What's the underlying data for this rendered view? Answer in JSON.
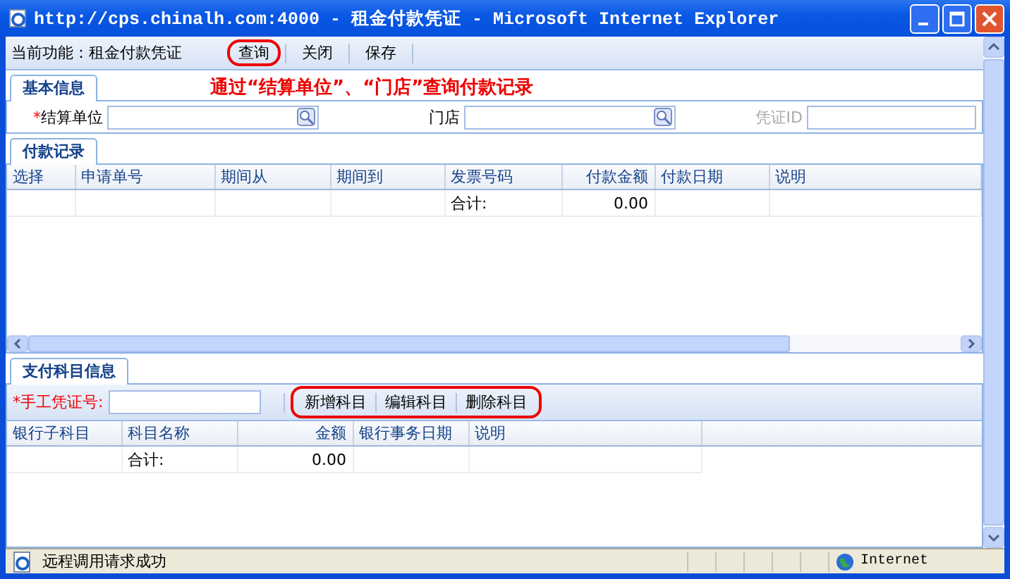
{
  "window": {
    "title": "http://cps.chinalh.com:4000 - 租金付款凭证 - Microsoft Internet Explorer"
  },
  "toolbar": {
    "label": "当前功能：",
    "value": "租金付款凭证",
    "buttons": [
      {
        "label": "查询",
        "circled": true
      },
      {
        "label": "关闭",
        "circled": false
      },
      {
        "label": "保存",
        "circled": false
      }
    ]
  },
  "basic_info": {
    "tab": {
      "label": "基本信息",
      "selected": true
    },
    "annotation": "通过“结算单位”、“门店”查询付款记录",
    "fields": [
      {
        "kind": "lookup",
        "required_mark": "*",
        "label": "结算单位",
        "disabled": false
      },
      {
        "kind": "lookup",
        "label": "门店",
        "disabled": false
      },
      {
        "kind": "text",
        "label": "凭证ID",
        "disabled": true
      }
    ]
  },
  "payment_records": {
    "tab": {
      "label": "付款记录",
      "selected": true
    },
    "columns": [
      {
        "label": "选择",
        "align_right": false
      },
      {
        "label": "申请单号",
        "align_right": false
      },
      {
        "label": "期间从",
        "align_right": false
      },
      {
        "label": "期间到",
        "align_right": false
      },
      {
        "label": "发票号码",
        "align_right": false
      },
      {
        "label": "付款金额",
        "align_right": true
      },
      {
        "label": "付款日期",
        "align_right": false
      },
      {
        "label": "说明",
        "align_right": false
      }
    ],
    "rows": [
      [
        "",
        "",
        "",
        "",
        "合计:",
        "0.00",
        "",
        ""
      ]
    ]
  },
  "subjects": {
    "tab": {
      "label": "支付科目信息",
      "selected": true
    },
    "voucher_label": "*手工凭证号:",
    "buttons_circled": true,
    "buttons": [
      "新增科目",
      "编辑科目",
      "删除科目"
    ],
    "columns": [
      {
        "label": "银行子科目",
        "align_right": false
      },
      {
        "label": "科目名称",
        "align_right": false
      },
      {
        "label": "金额",
        "align_right": true
      },
      {
        "label": "银行事务日期",
        "align_right": false
      },
      {
        "label": "说明",
        "align_right": false
      }
    ],
    "rows": [
      [
        "",
        "合计:",
        "0.00",
        "",
        ""
      ]
    ]
  },
  "status_bar": {
    "message": "远程调用请求成功",
    "zone": "Internet"
  }
}
